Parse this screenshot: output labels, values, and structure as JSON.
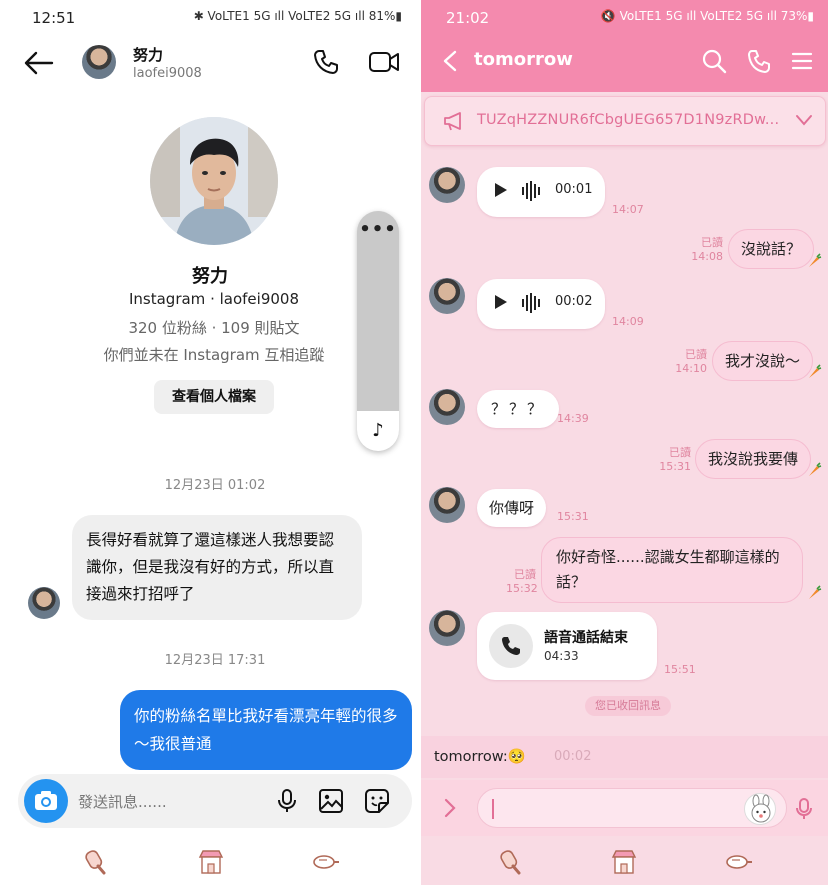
{
  "left": {
    "status_time": "12:51",
    "status_icons": "✱ VoLTE1 5G ıll VoLTE2 5G ıll 81%▮",
    "header": {
      "name": "努力",
      "username": "laofei9008"
    },
    "profile": {
      "name": "努力",
      "line1": "Instagram · laofei9008",
      "line2": "320 位粉絲 · 109 則貼文",
      "line3": "你們並未在 Instagram 互相追蹤",
      "view_button": "查看個人檔案"
    },
    "float_bar": {
      "dots": "•••",
      "music": "♪"
    },
    "messages": [
      {
        "timestamp": "12月23日 01:02",
        "text": "長得好看就算了還這樣迷人我想要認識你，但是我沒有好的方式，所以直接過來打招呼了"
      },
      {
        "timestamp": "12月23日 17:31",
        "text": "你的粉絲名單比我好看漂亮年輕的很多～我很普通"
      }
    ],
    "compose_placeholder": "發送訊息......"
  },
  "right": {
    "status_time": "21:02",
    "status_icons": "🔇 VoLTE1 5G ıll VoLTE2 5G ıll 73%▮",
    "title": "tomorrow",
    "announcement": "TUZqHZZNUR6fCbgUEG657D1N9zRDw...",
    "read_label": "已讀",
    "messages": [
      {
        "dir": "in",
        "kind": "voice",
        "duration": "00:01",
        "time": "14:07"
      },
      {
        "dir": "out",
        "text": "沒說話？",
        "time": "14:08"
      },
      {
        "dir": "in",
        "kind": "voice",
        "duration": "00:02",
        "time": "14:09"
      },
      {
        "dir": "out",
        "text": "我才沒說～",
        "time": "14:10"
      },
      {
        "dir": "in",
        "text": "？？？",
        "time": "14:39"
      },
      {
        "dir": "out",
        "text": "我沒說我要傳",
        "time": "15:31"
      },
      {
        "dir": "in",
        "text": "你傳呀",
        "time": "15:31"
      },
      {
        "dir": "out",
        "text": "你好奇怪......認識女生都聊這樣的話？",
        "time": "15:32"
      },
      {
        "dir": "in",
        "kind": "call",
        "title": "語音通話結束",
        "duration": "04:33",
        "time": "15:51"
      }
    ],
    "recalled": "您已收回訊息",
    "typing_line": "tomorrow:🥺",
    "ghost_duration": "00:02"
  },
  "colors": {
    "ig_blue": "#1f7ae8",
    "line_pink": "#f48aae",
    "line_bg": "#f9dbe4"
  }
}
